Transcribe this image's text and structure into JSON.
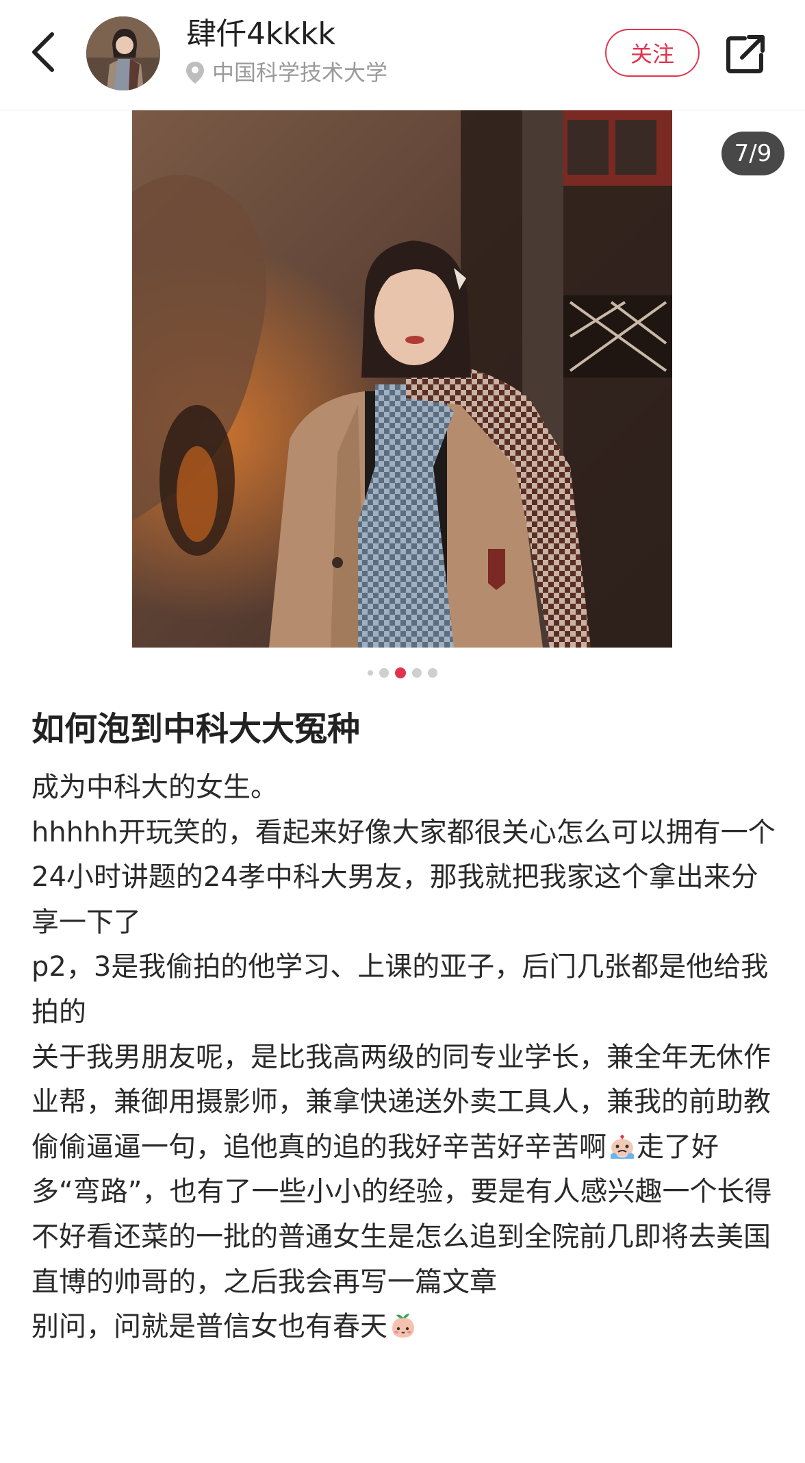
{
  "header": {
    "back_icon": "chevron-left-icon",
    "username": "肆仟4kkkk",
    "location_icon": "location-pin-icon",
    "location": "中国科学技术大学",
    "follow_label": "关注",
    "share_icon": "share-icon",
    "accent_color": "#e0344d"
  },
  "carousel": {
    "counter": "7/9",
    "current": 7,
    "total": 9
  },
  "post": {
    "title": "如何泡到中科大大冤种",
    "paragraphs": [
      "成为中科大的女生。",
      "hhhhh开玩笑的，看起来好像大家都很关心怎么可以拥有一个24小时讲题的24孝中科大男友，那我就把我家这个拿出来分享一下了",
      "p2，3是我偷拍的他学习、上课的亚子，后门几张都是他给我拍的",
      "关于我男朋友呢，是比我高两级的同专业学长，兼全年无休作业帮，兼御用摄影师，兼拿快递送外卖工具人，兼我的前助教",
      "偷偷逼逼一句，追他真的追的我好辛苦好辛苦啊",
      "走了好多“弯路”，也有了一些小小的经验，要是有人感兴趣一个长得不好看还菜的一批的普通女生是怎么追到全院前几即将去美国直博的帅哥的，之后我会再写一篇文章",
      "别问，问就是普信女也有春天"
    ],
    "emoji_1": "crying-emoji",
    "emoji_2": "peach-emoji"
  }
}
